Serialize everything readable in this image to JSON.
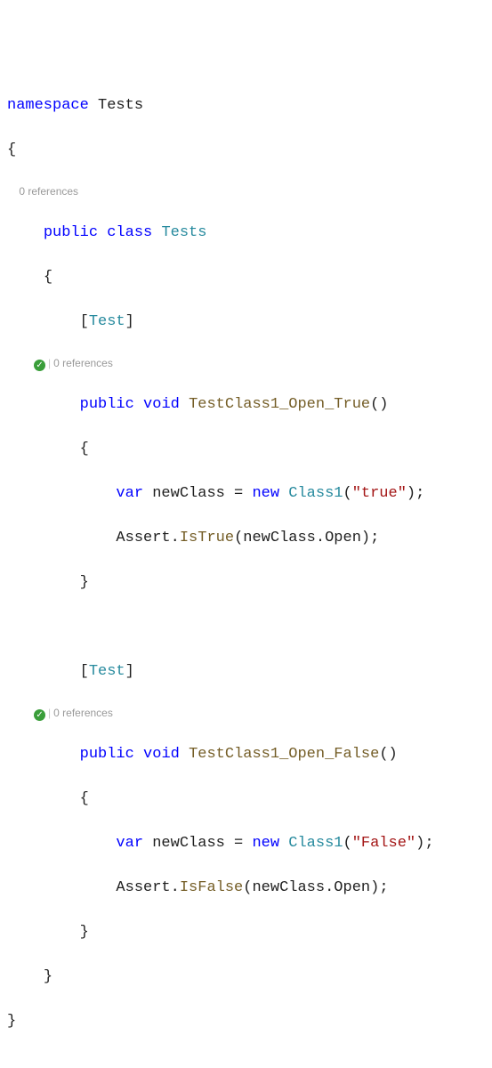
{
  "code": {
    "ns_kw": "namespace",
    "ns_name": "Tests",
    "brace_open": "{",
    "brace_close": "}",
    "class_codelens": "0 references",
    "public_kw": "public",
    "class_kw": "class",
    "class_name": "Tests",
    "attr_open": "[",
    "attr_close": "]",
    "attr_name": "Test",
    "method1_codelens": "0 references",
    "void_kw": "void",
    "method1_name": "TestClass1_Open_True",
    "parens": "()",
    "var_kw": "var",
    "var_name": "newClass",
    "eq": " = ",
    "new_kw": "new",
    "ctor_type": "Class1",
    "paren_open": "(",
    "paren_close": ")",
    "semicolon": ";",
    "str_true": "\"true\"",
    "str_false": "\"False\"",
    "assert_type": "Assert",
    "dot": ".",
    "isTrue": "IsTrue",
    "isFalse": "IsFalse",
    "open_prop": "Open",
    "method2_codelens": "0 references",
    "method2_name": "TestClass1_Open_False"
  },
  "icons": {
    "pass_check": "✓",
    "codelens_sep": "|"
  }
}
